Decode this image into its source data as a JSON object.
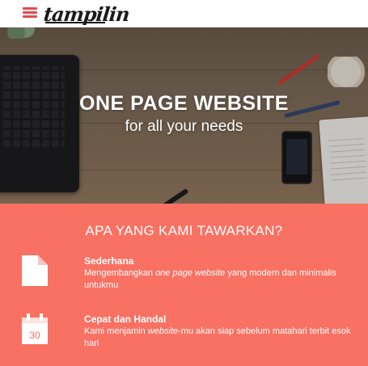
{
  "nav": {
    "menu_icon": "hamburger-menu-icon",
    "logo": "tampilin"
  },
  "hero": {
    "title": "ONE PAGE WEBSITE",
    "subtitle": "for all your needs"
  },
  "offers": {
    "title": "APA YANG KAMI TAWARKAN?",
    "features": [
      {
        "icon": "document-icon",
        "heading": "Sederhana",
        "text_before": "Mengembangkan ",
        "text_em": "one page website",
        "text_after": " yang modern dan minimalis untukmu"
      },
      {
        "icon": "calendar-icon",
        "icon_label": "30",
        "heading": "Cepat dan Handal",
        "text_before": "Kami menjamin ",
        "text_em": "website",
        "text_after": "-mu akan siap sebelum matahari terbit esok hari"
      }
    ]
  },
  "colors": {
    "accent": "#e64a4e",
    "section_bg": "#f97162",
    "hero_text": "#ffffff"
  }
}
